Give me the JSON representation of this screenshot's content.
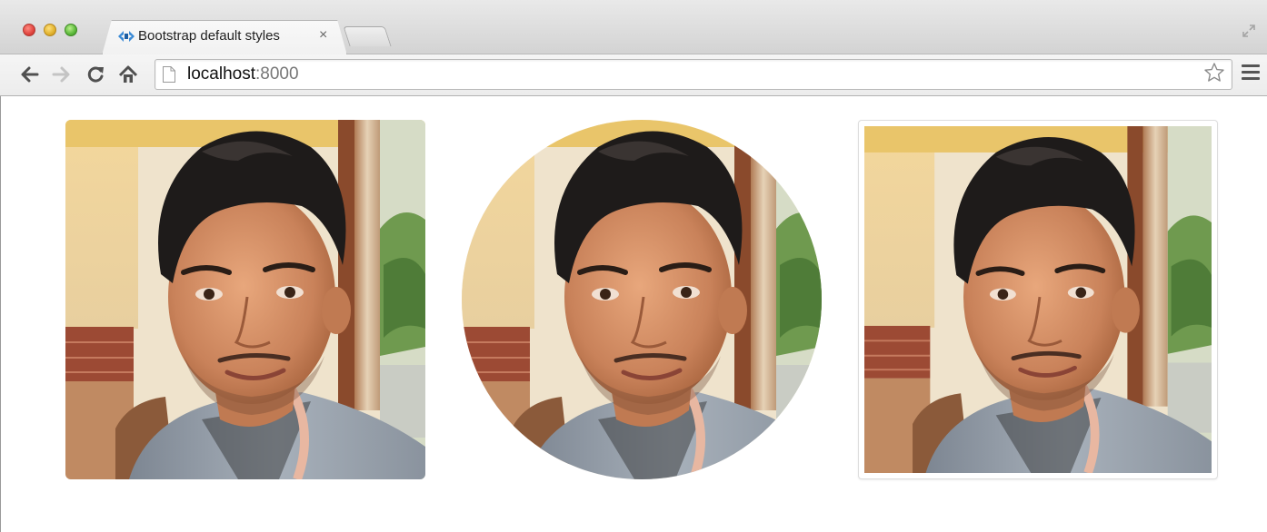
{
  "browser": {
    "tab_title": "Bootstrap default styles",
    "tab_close_glyph": "×",
    "url_host": "localhost",
    "url_port": ":8000"
  },
  "icons": {
    "back": "back-arrow-icon",
    "forward": "forward-arrow-icon",
    "reload": "reload-icon",
    "home": "home-icon",
    "star": "bookmark-star-icon",
    "menu": "hamburger-menu-icon"
  },
  "images": [
    {
      "style": "img-rounded"
    },
    {
      "style": "img-circle"
    },
    {
      "style": "img-thumbnail"
    }
  ]
}
